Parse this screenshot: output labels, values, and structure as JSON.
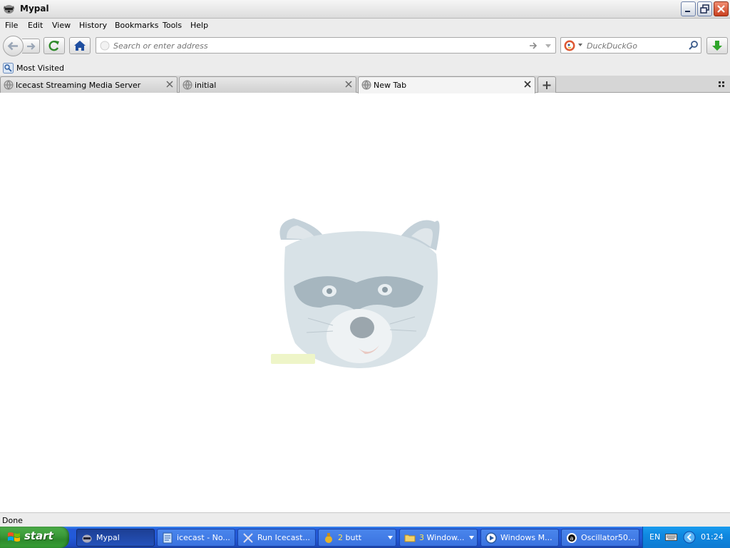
{
  "window": {
    "title": "Mypal"
  },
  "menu": [
    {
      "label": "File"
    },
    {
      "label": "Edit"
    },
    {
      "label": "View"
    },
    {
      "label": "History"
    },
    {
      "label": "Bookmarks"
    },
    {
      "label": "Tools"
    },
    {
      "label": "Help"
    }
  ],
  "navbar": {
    "url_placeholder": "Search or enter address",
    "url_value": "",
    "search_placeholder": "DuckDuckGo",
    "search_value": ""
  },
  "bookmarks": [
    {
      "label": "Most Visited",
      "icon": "most-visited-icon"
    }
  ],
  "tabs": [
    {
      "label": "Icecast Streaming Media Server",
      "active": false
    },
    {
      "label": "initial",
      "active": false
    },
    {
      "label": "New Tab",
      "active": true
    }
  ],
  "status": {
    "text": "Done"
  },
  "taskbar": {
    "start_label": "start",
    "tasks": [
      {
        "label": "Mypal",
        "active": true,
        "icon": "mypal-icon"
      },
      {
        "label": "icecast - No...",
        "icon": "notepad-icon"
      },
      {
        "label": "Run Icecast...",
        "icon": "run-icecast-icon"
      },
      {
        "count": "2",
        "label": "butt",
        "icon": "butt-icon",
        "grouped": true
      },
      {
        "count": "3",
        "label": "Window...",
        "icon": "folder-icon",
        "grouped": true
      },
      {
        "label": "Windows M...",
        "icon": "media-player-icon"
      },
      {
        "label": "Oscillator50...",
        "icon": "oscillator-icon"
      }
    ],
    "tray": {
      "language": "EN",
      "clock": "01:24"
    }
  },
  "colors": {
    "taskbar_blue": "#225ad9",
    "start_green": "#3c9a3a",
    "tray_blue": "#0f88e0"
  }
}
